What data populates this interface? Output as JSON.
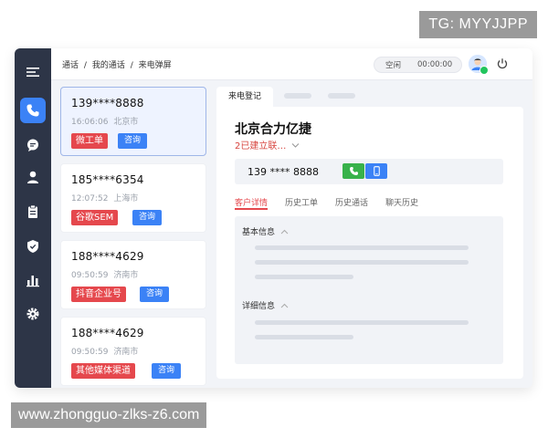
{
  "watermarks": {
    "top": "TG: MYYJJPP",
    "bottom": "www.zhongguo-zlks-z6.com"
  },
  "sidebar": {
    "items": [
      {
        "icon": "menu-icon"
      },
      {
        "icon": "phone-icon",
        "active": true
      },
      {
        "icon": "chat-icon"
      },
      {
        "icon": "user-icon"
      },
      {
        "icon": "clipboard-icon"
      },
      {
        "icon": "shield-icon"
      },
      {
        "icon": "bar-chart-icon"
      },
      {
        "icon": "gear-icon"
      }
    ],
    "colors": {
      "background": "#2d3547",
      "active": "#3b82f6"
    }
  },
  "topbar": {
    "breadcrumb": [
      "通话",
      "我的通话",
      "来电弹屏"
    ],
    "separator": "/",
    "status": "空闲",
    "timer": "00:00:00"
  },
  "calls": [
    {
      "phone": "139****8888",
      "time": "16:06:06",
      "city": "北京市",
      "tag": "微工单",
      "action": "咨询",
      "selected": true
    },
    {
      "phone": "185****6354",
      "time": "12:07:52",
      "city": "上海市",
      "tag": "谷歌SEM",
      "action": "咨询"
    },
    {
      "phone": "188****4629",
      "time": "09:50:59",
      "city": "济南市",
      "tag": "抖音企业号",
      "action": "咨询"
    },
    {
      "phone": "188****4629",
      "time": "09:50:59",
      "city": "济南市",
      "tag": "其他媒体渠道",
      "action": "咨询"
    }
  ],
  "detail": {
    "tab_label": "来电登记",
    "company": "北京合力亿捷",
    "linked": "2已建立联…",
    "phone": "139 **** 8888",
    "subtabs": [
      "客户详情",
      "历史工单",
      "历史通话",
      "聊天历史"
    ],
    "sections": [
      "基本信息",
      "详细信息"
    ]
  },
  "colors": {
    "accent": "#3b82f6",
    "tag": "#e5484d",
    "call": "#38b24a"
  }
}
